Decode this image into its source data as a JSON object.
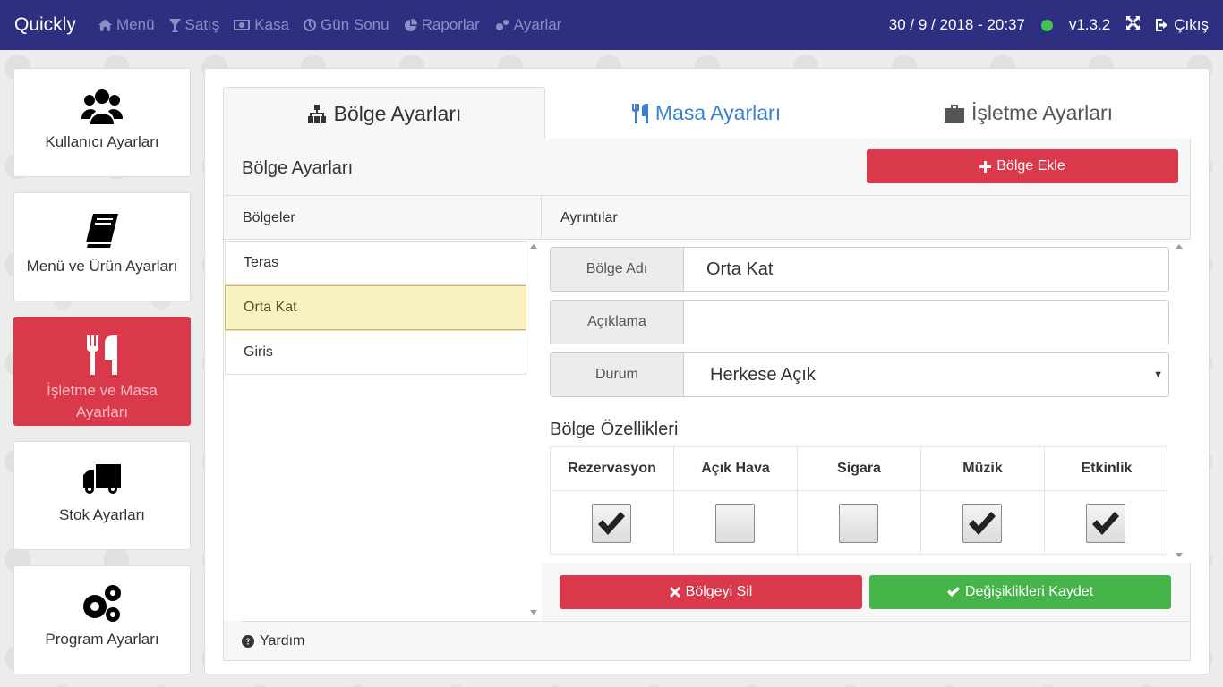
{
  "app": {
    "brand": "Quickly"
  },
  "nav": {
    "items": [
      {
        "label": "Menü",
        "icon": "home-icon"
      },
      {
        "label": "Satış",
        "icon": "glass-icon"
      },
      {
        "label": "Kasa",
        "icon": "money-icon"
      },
      {
        "label": "Gün Sonu",
        "icon": "clock-icon"
      },
      {
        "label": "Raporlar",
        "icon": "pie-chart-icon"
      },
      {
        "label": "Ayarlar",
        "icon": "gears-icon"
      }
    ],
    "datetime": "30 / 9 / 2018 - 20:37",
    "status_color": "#43c257",
    "version": "v1.3.2",
    "exit_label": "Çıkış"
  },
  "sidebar": {
    "items": [
      {
        "label": "Kullanıcı Ayarları",
        "icon": "users-icon"
      },
      {
        "label": "Menü ve Ürün Ayarları",
        "icon": "book-icon"
      },
      {
        "label": "İşletme ve Masa Ayarları",
        "icon": "cutlery-icon",
        "active": true
      },
      {
        "label": "Stok Ayarları",
        "icon": "truck-icon"
      },
      {
        "label": "Program Ayarları",
        "icon": "gears-icon"
      }
    ]
  },
  "tabs": [
    {
      "label": "Bölge Ayarları",
      "icon": "sitemap-icon"
    },
    {
      "label": "Masa Ayarları",
      "icon": "cutlery-icon"
    },
    {
      "label": "İşletme Ayarları",
      "icon": "briefcase-icon"
    }
  ],
  "section": {
    "title": "Bölge Ayarları",
    "add_button": "Bölge Ekle"
  },
  "regions": {
    "header": "Bölgeler",
    "items": [
      "Teras",
      "Orta Kat",
      "Giris"
    ],
    "selected": "Orta Kat"
  },
  "details": {
    "header": "Ayrıntılar",
    "name_label": "Bölge Adı",
    "name_value": "Orta Kat",
    "desc_label": "Açıklama",
    "desc_value": "",
    "status_label": "Durum",
    "status_value": "Herkese Açık",
    "features_title": "Bölge Özellikleri",
    "features": [
      {
        "label": "Rezervasyon",
        "checked": true
      },
      {
        "label": "Açık Hava",
        "checked": false
      },
      {
        "label": "Sigara",
        "checked": false
      },
      {
        "label": "Müzik",
        "checked": true
      },
      {
        "label": "Etkinlik",
        "checked": true
      }
    ]
  },
  "actions": {
    "delete_label": "Bölgeyi Sil",
    "save_label": "Değişiklikleri Kaydet"
  },
  "help": {
    "label": "Yardım"
  },
  "colors": {
    "topbar": "#2f2f82",
    "danger": "#d9394a",
    "success": "#45b54a",
    "link": "#3b7fd0",
    "selected_row": "#f8f1c1"
  }
}
